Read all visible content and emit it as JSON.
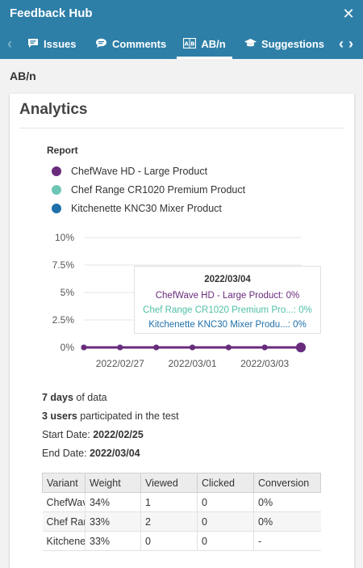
{
  "window": {
    "title": "Feedback Hub",
    "close_icon": "close-icon"
  },
  "tabs": [
    {
      "label": "Issues",
      "icon": "chat-bubble-icon"
    },
    {
      "label": "Comments",
      "icon": "comment-icon"
    },
    {
      "label": "AB/n",
      "icon": "ab-icon",
      "active": true
    },
    {
      "label": "Suggestions",
      "icon": "graduation-cap-icon"
    }
  ],
  "section_label": "AB/n",
  "card": {
    "title": "Analytics",
    "report_title": "Report",
    "legend": [
      {
        "label": "ChefWave HD - Large Product",
        "color": "#6a2b7d"
      },
      {
        "label": "Chef Range CR1020 Premium Product",
        "color": "#6cc6b4"
      },
      {
        "label": "Kitchenette KNC30 Mixer Product",
        "color": "#1f6fa8"
      }
    ],
    "tooltip": {
      "date": "2022/03/04",
      "lines": [
        {
          "text": "ChefWave HD - Large Product: 0%",
          "color": "#6a2b7d"
        },
        {
          "text": "Chef Range CR1020 Premium Pro...: 0%",
          "color": "#4fbfa7"
        },
        {
          "text": "Kitchenette KNC30 Mixer Produ...: 0%",
          "color": "#1f6fa8"
        }
      ]
    },
    "stats": {
      "days_value": "7 days",
      "days_suffix": " of data",
      "users_value": "3 users",
      "users_suffix": " participated in the test",
      "start_label": "Start Date: ",
      "start_value": "2022/02/25",
      "end_label": "End Date: ",
      "end_value": "2022/03/04"
    },
    "table": {
      "headers": [
        "Variant",
        "Weight",
        "Viewed",
        "Clicked",
        "Conversion"
      ],
      "rows": [
        [
          "ChefWave",
          "34%",
          "1",
          "0",
          "0%"
        ],
        [
          "Chef Range",
          "33%",
          "2",
          "0",
          "0%"
        ],
        [
          "Kitchenette",
          "33%",
          "0",
          "0",
          "-"
        ]
      ]
    }
  },
  "chart_data": {
    "type": "line",
    "x": [
      "2022/02/26",
      "2022/02/27",
      "2022/02/28",
      "2022/03/01",
      "2022/03/02",
      "2022/03/03",
      "2022/03/04"
    ],
    "x_tick_labels": [
      "2022/02/27",
      "2022/03/01",
      "2022/03/03"
    ],
    "y_tick_labels": [
      "0%",
      "2.5%",
      "5%",
      "7.5%",
      "10%"
    ],
    "ylim": [
      0,
      10
    ],
    "series": [
      {
        "name": "ChefWave HD - Large Product",
        "values": [
          0,
          0,
          0,
          0,
          0,
          0,
          0
        ],
        "color": "#6a2b7d"
      },
      {
        "name": "Chef Range CR1020 Premium Product",
        "values": [
          0,
          0,
          0,
          0,
          0,
          0,
          0
        ],
        "color": "#6cc6b4"
      },
      {
        "name": "Kitchenette KNC30 Mixer Product",
        "values": [
          0,
          0,
          0,
          0,
          0,
          0,
          0
        ],
        "color": "#1f6fa8"
      }
    ],
    "highlighted_x": "2022/03/04",
    "grid": true
  }
}
